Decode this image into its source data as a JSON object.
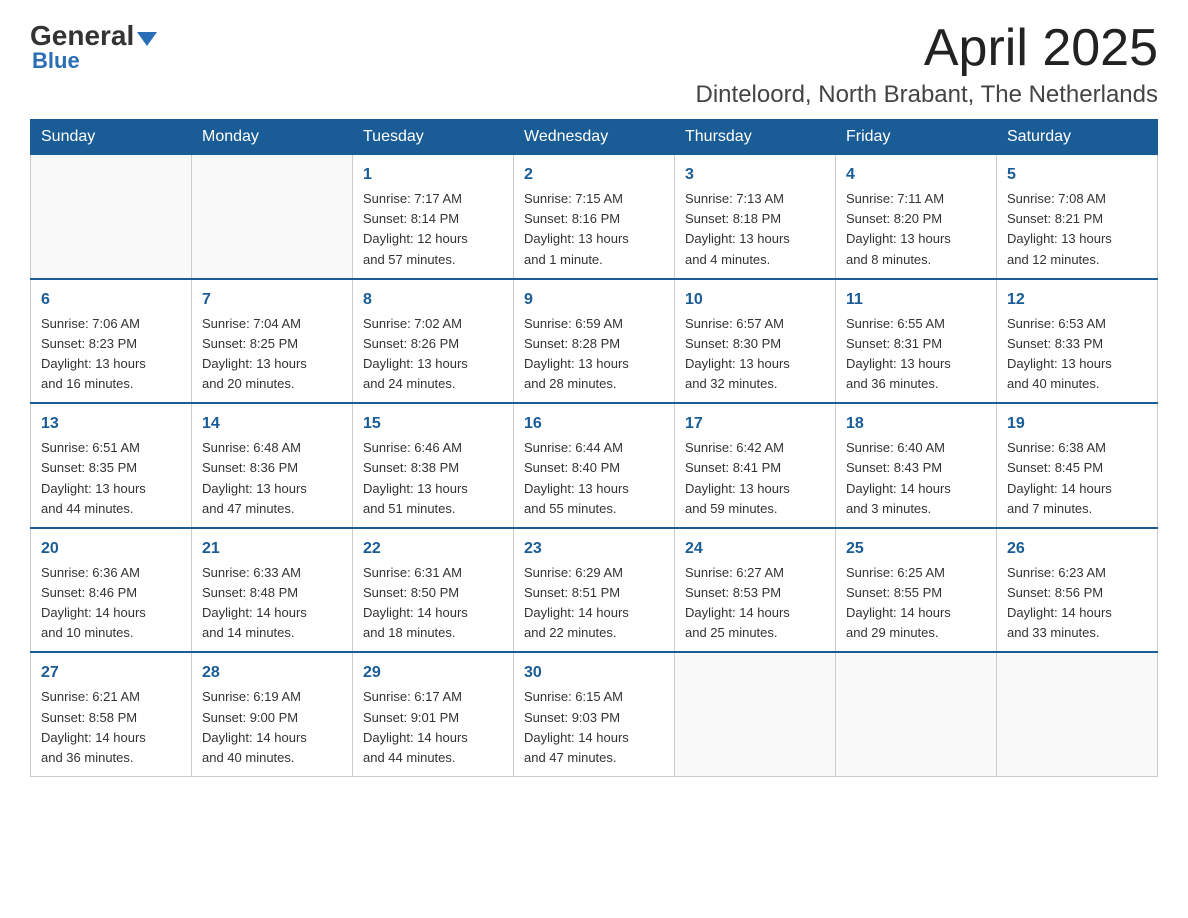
{
  "logo": {
    "general": "General",
    "blue": "Blue"
  },
  "title": "April 2025",
  "location": "Dinteloord, North Brabant, The Netherlands",
  "days_of_week": [
    "Sunday",
    "Monday",
    "Tuesday",
    "Wednesday",
    "Thursday",
    "Friday",
    "Saturday"
  ],
  "weeks": [
    [
      {
        "day": "",
        "info": ""
      },
      {
        "day": "",
        "info": ""
      },
      {
        "day": "1",
        "info": "Sunrise: 7:17 AM\nSunset: 8:14 PM\nDaylight: 12 hours\nand 57 minutes."
      },
      {
        "day": "2",
        "info": "Sunrise: 7:15 AM\nSunset: 8:16 PM\nDaylight: 13 hours\nand 1 minute."
      },
      {
        "day": "3",
        "info": "Sunrise: 7:13 AM\nSunset: 8:18 PM\nDaylight: 13 hours\nand 4 minutes."
      },
      {
        "day": "4",
        "info": "Sunrise: 7:11 AM\nSunset: 8:20 PM\nDaylight: 13 hours\nand 8 minutes."
      },
      {
        "day": "5",
        "info": "Sunrise: 7:08 AM\nSunset: 8:21 PM\nDaylight: 13 hours\nand 12 minutes."
      }
    ],
    [
      {
        "day": "6",
        "info": "Sunrise: 7:06 AM\nSunset: 8:23 PM\nDaylight: 13 hours\nand 16 minutes."
      },
      {
        "day": "7",
        "info": "Sunrise: 7:04 AM\nSunset: 8:25 PM\nDaylight: 13 hours\nand 20 minutes."
      },
      {
        "day": "8",
        "info": "Sunrise: 7:02 AM\nSunset: 8:26 PM\nDaylight: 13 hours\nand 24 minutes."
      },
      {
        "day": "9",
        "info": "Sunrise: 6:59 AM\nSunset: 8:28 PM\nDaylight: 13 hours\nand 28 minutes."
      },
      {
        "day": "10",
        "info": "Sunrise: 6:57 AM\nSunset: 8:30 PM\nDaylight: 13 hours\nand 32 minutes."
      },
      {
        "day": "11",
        "info": "Sunrise: 6:55 AM\nSunset: 8:31 PM\nDaylight: 13 hours\nand 36 minutes."
      },
      {
        "day": "12",
        "info": "Sunrise: 6:53 AM\nSunset: 8:33 PM\nDaylight: 13 hours\nand 40 minutes."
      }
    ],
    [
      {
        "day": "13",
        "info": "Sunrise: 6:51 AM\nSunset: 8:35 PM\nDaylight: 13 hours\nand 44 minutes."
      },
      {
        "day": "14",
        "info": "Sunrise: 6:48 AM\nSunset: 8:36 PM\nDaylight: 13 hours\nand 47 minutes."
      },
      {
        "day": "15",
        "info": "Sunrise: 6:46 AM\nSunset: 8:38 PM\nDaylight: 13 hours\nand 51 minutes."
      },
      {
        "day": "16",
        "info": "Sunrise: 6:44 AM\nSunset: 8:40 PM\nDaylight: 13 hours\nand 55 minutes."
      },
      {
        "day": "17",
        "info": "Sunrise: 6:42 AM\nSunset: 8:41 PM\nDaylight: 13 hours\nand 59 minutes."
      },
      {
        "day": "18",
        "info": "Sunrise: 6:40 AM\nSunset: 8:43 PM\nDaylight: 14 hours\nand 3 minutes."
      },
      {
        "day": "19",
        "info": "Sunrise: 6:38 AM\nSunset: 8:45 PM\nDaylight: 14 hours\nand 7 minutes."
      }
    ],
    [
      {
        "day": "20",
        "info": "Sunrise: 6:36 AM\nSunset: 8:46 PM\nDaylight: 14 hours\nand 10 minutes."
      },
      {
        "day": "21",
        "info": "Sunrise: 6:33 AM\nSunset: 8:48 PM\nDaylight: 14 hours\nand 14 minutes."
      },
      {
        "day": "22",
        "info": "Sunrise: 6:31 AM\nSunset: 8:50 PM\nDaylight: 14 hours\nand 18 minutes."
      },
      {
        "day": "23",
        "info": "Sunrise: 6:29 AM\nSunset: 8:51 PM\nDaylight: 14 hours\nand 22 minutes."
      },
      {
        "day": "24",
        "info": "Sunrise: 6:27 AM\nSunset: 8:53 PM\nDaylight: 14 hours\nand 25 minutes."
      },
      {
        "day": "25",
        "info": "Sunrise: 6:25 AM\nSunset: 8:55 PM\nDaylight: 14 hours\nand 29 minutes."
      },
      {
        "day": "26",
        "info": "Sunrise: 6:23 AM\nSunset: 8:56 PM\nDaylight: 14 hours\nand 33 minutes."
      }
    ],
    [
      {
        "day": "27",
        "info": "Sunrise: 6:21 AM\nSunset: 8:58 PM\nDaylight: 14 hours\nand 36 minutes."
      },
      {
        "day": "28",
        "info": "Sunrise: 6:19 AM\nSunset: 9:00 PM\nDaylight: 14 hours\nand 40 minutes."
      },
      {
        "day": "29",
        "info": "Sunrise: 6:17 AM\nSunset: 9:01 PM\nDaylight: 14 hours\nand 44 minutes."
      },
      {
        "day": "30",
        "info": "Sunrise: 6:15 AM\nSunset: 9:03 PM\nDaylight: 14 hours\nand 47 minutes."
      },
      {
        "day": "",
        "info": ""
      },
      {
        "day": "",
        "info": ""
      },
      {
        "day": "",
        "info": ""
      }
    ]
  ]
}
